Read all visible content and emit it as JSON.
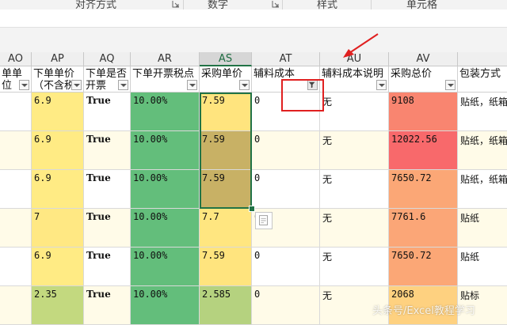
{
  "ribbon": {
    "groups": [
      "对齐方式",
      "数字",
      "样式",
      "单元格"
    ]
  },
  "columns": [
    "AO",
    "AP",
    "AQ",
    "AR",
    "AS",
    "AT",
    "AU",
    "AV",
    ""
  ],
  "selected_column": "AS",
  "headers": {
    "AO": "单单位",
    "AP": "下单单价（不含税",
    "AQ": "下单是否开票",
    "AR": "下单开票税点",
    "AS": "采购单价",
    "AT": "辅料成本",
    "AU": "辅料成本说明",
    "AV": "采购总价",
    "AW": "包装方式"
  },
  "rows": [
    {
      "AP": "6.9",
      "AQ": "True",
      "AR": "10.00%",
      "AS": "7.59",
      "AT": "0",
      "AU": "无",
      "AV": "9108",
      "AW": "贴纸，纸箱"
    },
    {
      "AP": "6.9",
      "AQ": "True",
      "AR": "10.00%",
      "AS": "7.59",
      "AT": "0",
      "AU": "无",
      "AV": "12022.56",
      "AW": "贴纸，纸箱"
    },
    {
      "AP": "6.9",
      "AQ": "True",
      "AR": "10.00%",
      "AS": "7.59",
      "AT": "0",
      "AU": "无",
      "AV": "7650.72",
      "AW": "贴纸，纸箱"
    },
    {
      "AP": "7",
      "AQ": "True",
      "AR": "10.00%",
      "AS": "7.7",
      "AT": "0",
      "AU": "无",
      "AV": "7761.6",
      "AW": "贴纸"
    },
    {
      "AP": "6.9",
      "AQ": "True",
      "AR": "10.00%",
      "AS": "7.59",
      "AT": "0",
      "AU": "无",
      "AV": "7650.72",
      "AW": "贴纸"
    },
    {
      "AP": "2.35",
      "AQ": "True",
      "AR": "10.00%",
      "AS": "2.585",
      "AT": "0",
      "AU": "无",
      "AV": "2068",
      "AW": "贴标"
    }
  ],
  "colors": {
    "AR_fill": "#63be7b",
    "selection": "#217346",
    "annotation": "#e02020",
    "AP_fills": [
      "#ffeb84",
      "#ffeb84",
      "#ffeb84",
      "#ffe883",
      "#ffeb84",
      "#c3d97f"
    ],
    "AS_fills": [
      "#ffe47e",
      "#c8b165",
      "#c8b165",
      "#ffe680",
      "#ffe47e",
      "#b5d27f"
    ],
    "AV_fills": [
      "#f98570",
      "#f8696b",
      "#fba776",
      "#fba677",
      "#fba776",
      "#fed180"
    ],
    "row_bands": [
      "#ffffff",
      "#fffbe8",
      "#ffffff",
      "#fffbe8",
      "#ffffff",
      "#fffbe8"
    ]
  },
  "watermark": "头条号/Excel教程学习"
}
